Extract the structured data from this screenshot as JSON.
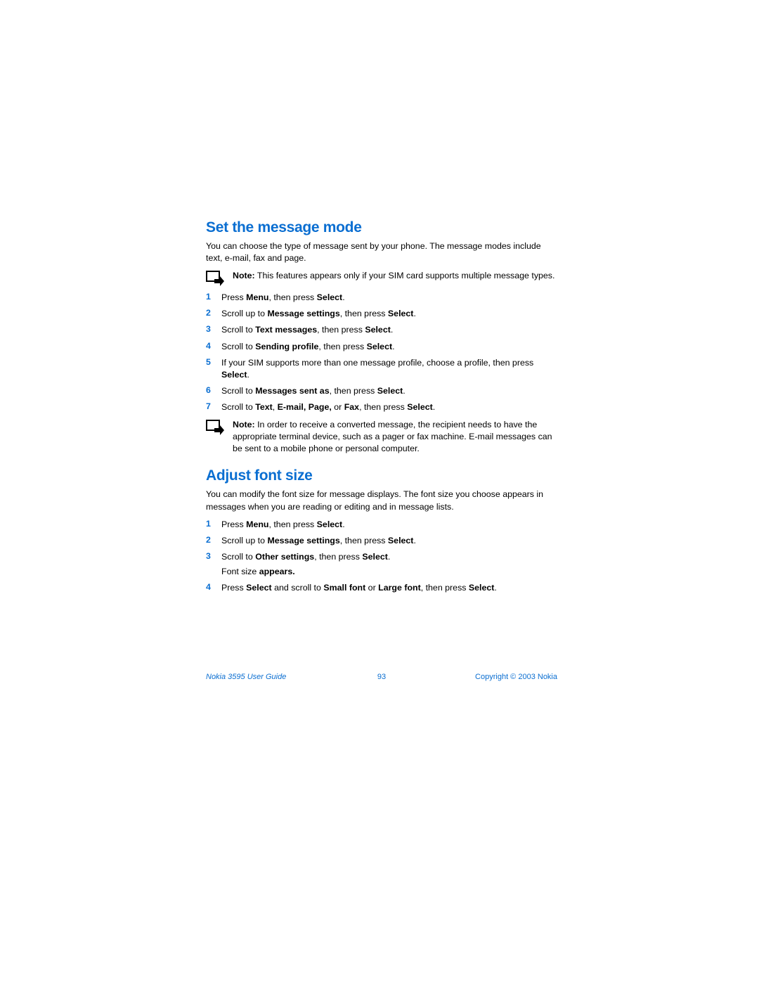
{
  "section1": {
    "heading": "Set the message mode",
    "intro": "You can choose the type of message sent by your phone. The message modes include text, e-mail, fax and page.",
    "note1": {
      "label": "Note:",
      "text": " This features appears only if your SIM card supports multiple message types."
    },
    "steps": [
      {
        "num": "1",
        "parts": [
          "Press ",
          "Menu",
          ", then press ",
          "Select",
          "."
        ]
      },
      {
        "num": "2",
        "parts": [
          "Scroll up to ",
          "Message settings",
          ", then press ",
          "Select",
          "."
        ]
      },
      {
        "num": "3",
        "parts": [
          "Scroll to ",
          "Text messages",
          ", then press ",
          "Select",
          "."
        ]
      },
      {
        "num": "4",
        "parts": [
          "Scroll to ",
          "Sending profile",
          ", then press ",
          "Select",
          "."
        ]
      },
      {
        "num": "5",
        "parts": [
          "If your SIM supports more than one message profile, choose a profile, then press ",
          "Select",
          "."
        ]
      },
      {
        "num": "6",
        "parts": [
          "Scroll to ",
          "Messages sent as",
          ", then press ",
          "Select",
          "."
        ]
      },
      {
        "num": "7",
        "parts": [
          "Scroll to ",
          "Text",
          ", ",
          "E-mail, Page,",
          " or ",
          "Fax",
          ", then press ",
          "Select",
          "."
        ]
      }
    ],
    "note2": {
      "label": "Note:",
      "text": " In order to receive a converted message, the recipient needs to have the appropriate terminal device, such as a pager or fax machine. E-mail messages can be sent to a mobile phone or personal computer."
    }
  },
  "section2": {
    "heading": "Adjust font size",
    "intro": "You can modify the font size for message displays. The font size you choose appears in messages when you are reading or editing and in message lists.",
    "steps": [
      {
        "num": "1",
        "parts": [
          "Press ",
          "Menu",
          ", then press ",
          "Select",
          "."
        ]
      },
      {
        "num": "2",
        "parts": [
          "Scroll up to ",
          "Message settings",
          ", then press ",
          "Select",
          "."
        ]
      },
      {
        "num": "3",
        "parts": [
          "Scroll to ",
          "Other settings",
          ", then press ",
          "Select",
          "."
        ],
        "sub": {
          "parts": [
            "Font size",
            " appears."
          ]
        }
      },
      {
        "num": "4",
        "parts": [
          "Press ",
          "Select",
          " and scroll to ",
          "Small font",
          " or ",
          "Large font",
          ", then press ",
          "Select",
          "."
        ]
      }
    ]
  },
  "footer": {
    "left": "Nokia 3595 User Guide",
    "center": "93",
    "right": "Copyright © 2003 Nokia"
  }
}
